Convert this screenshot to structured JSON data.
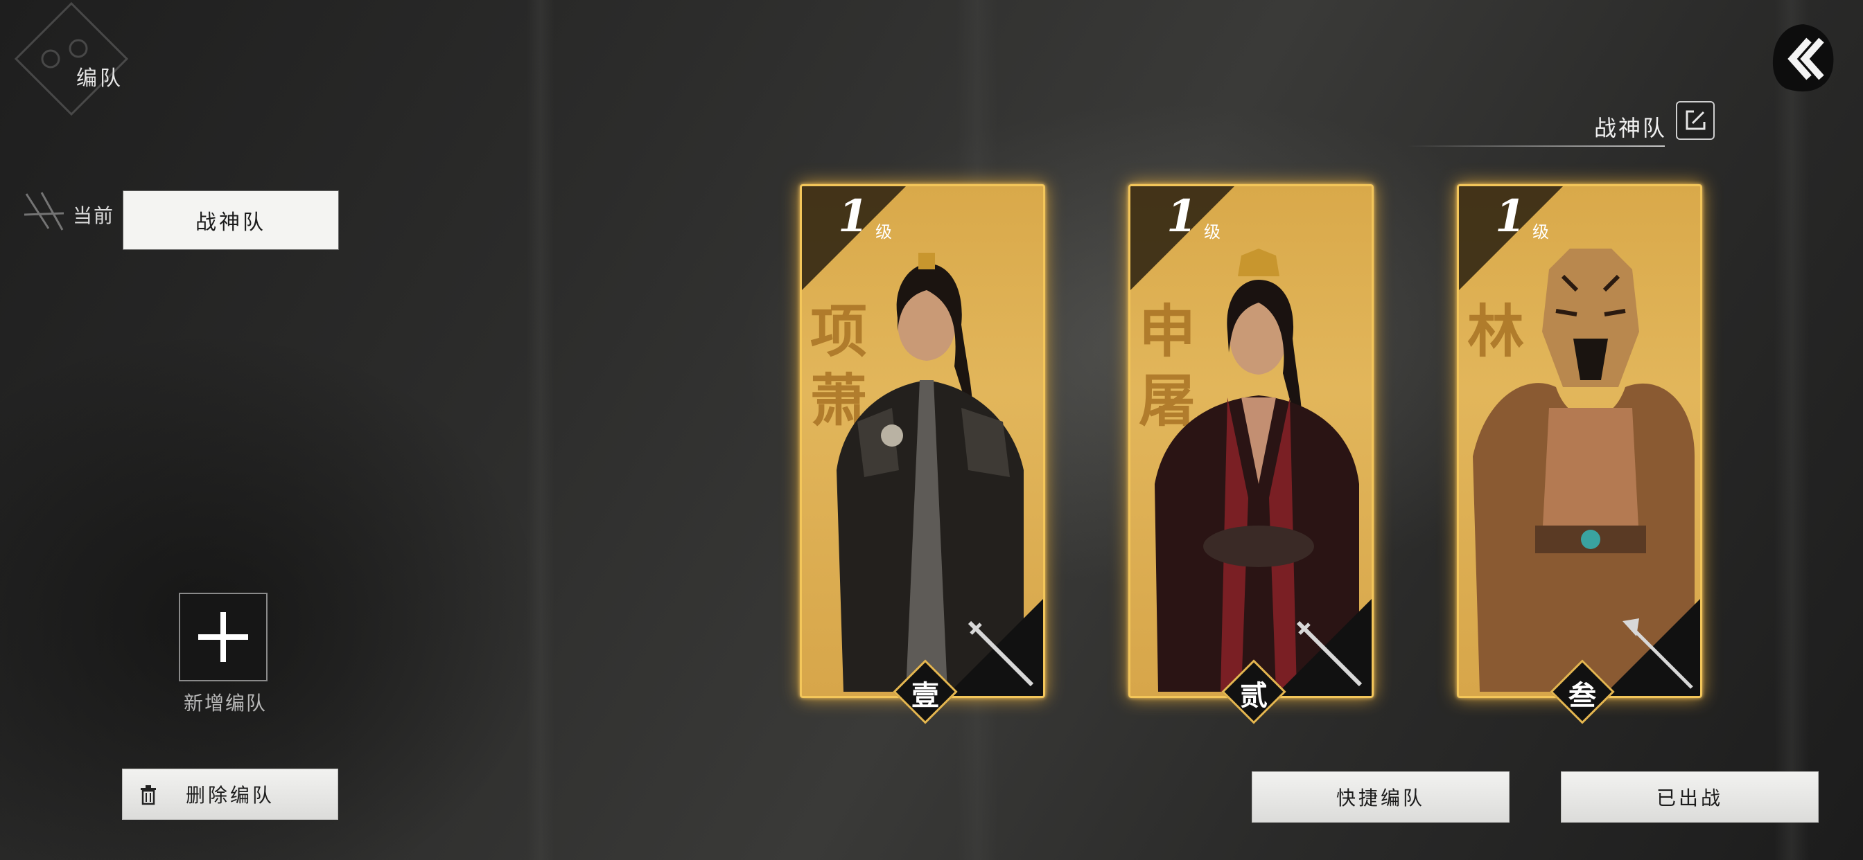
{
  "header": {
    "title": "编队"
  },
  "current": {
    "label": "当前",
    "team": "战神队"
  },
  "add_team": {
    "label": "新增编队"
  },
  "delete_button": {
    "label": "删除编队"
  },
  "team_header": {
    "name": "战神队"
  },
  "cards": [
    {
      "level": "1",
      "level_unit": "级",
      "name": "项萧",
      "slot": "壹",
      "weapon": "sword-icon"
    },
    {
      "level": "1",
      "level_unit": "级",
      "name": "申屠",
      "slot": "贰",
      "weapon": "sword-icon"
    },
    {
      "level": "1",
      "level_unit": "级",
      "name": "林",
      "slot": "叁",
      "weapon": "spear-icon"
    }
  ],
  "footer": {
    "quick_label": "快捷编队",
    "deploy_label": "已出战"
  },
  "colors": {
    "card_gold": "#e2b65b",
    "card_glow": "#f3c65a",
    "background": "#2c2c2b"
  }
}
